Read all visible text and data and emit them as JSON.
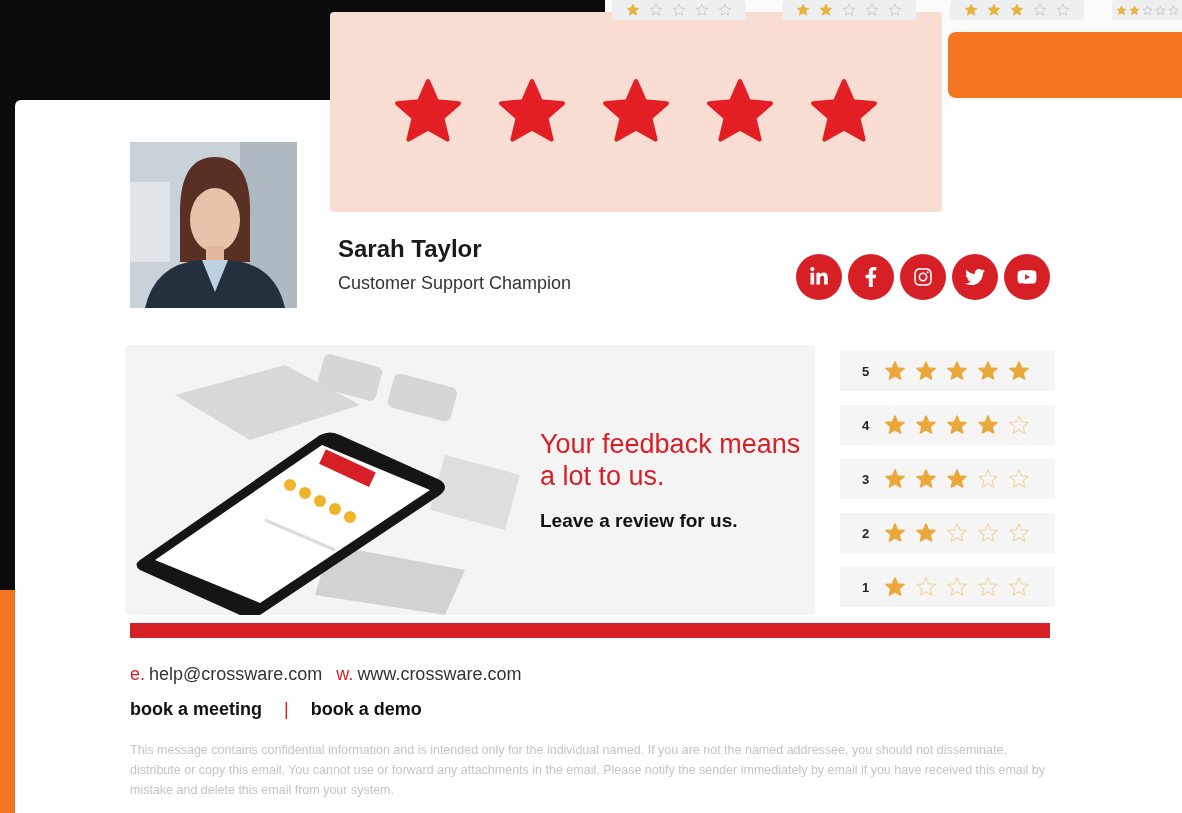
{
  "top_ratings": [
    {
      "stars": 1
    },
    {
      "stars": 2
    },
    {
      "stars": 3
    },
    {
      "stars": 2
    }
  ],
  "hero_rating": {
    "stars": 5
  },
  "signature": {
    "name": "Sarah Taylor",
    "title": "Customer Support Champion",
    "social": [
      {
        "kind": "linkedin"
      },
      {
        "kind": "facebook"
      },
      {
        "kind": "instagram"
      },
      {
        "kind": "twitter"
      },
      {
        "kind": "youtube"
      }
    ]
  },
  "banner": {
    "headline": "Your feedback means a lot to us.",
    "subline": "Leave a review for us."
  },
  "ratings": [
    {
      "label": "5",
      "stars": 5
    },
    {
      "label": "4",
      "stars": 4
    },
    {
      "label": "3",
      "stars": 3
    },
    {
      "label": "2",
      "stars": 2
    },
    {
      "label": "1",
      "stars": 1
    }
  ],
  "contacts": [
    {
      "prefix": "e.",
      "value": "help@crossware.com"
    },
    {
      "prefix": "w.",
      "value": "www.crossware.com"
    }
  ],
  "links": [
    "book a meeting",
    "book a demo"
  ],
  "link_separator": "|",
  "disclaimer": "This message contains confidential information and is intended only for the individual named. If you are not the named addressee, you should not disseminate, distribute or copy this email. You cannot use or forward any attachments in the email. Please notify the sender immediately by email if you have received this email by mistake and delete this email from your system."
}
